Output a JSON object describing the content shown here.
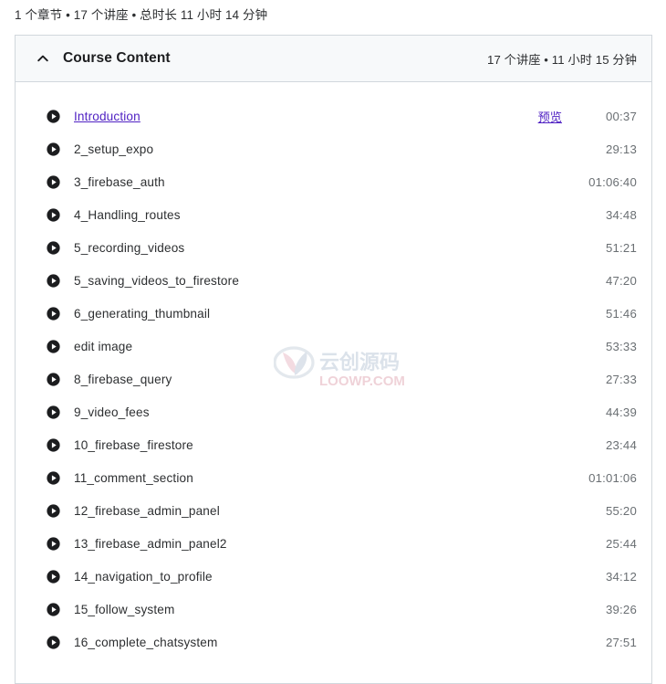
{
  "summary": {
    "text": "1 个章节 • 17 个讲座 • 总时长 11 小时 14 分钟"
  },
  "section": {
    "title": "Course Content",
    "meta": "17 个讲座 • 11 小时 15 分钟",
    "collapse_icon": "chevron-up-icon"
  },
  "colors": {
    "link": "#5022c3",
    "header_bg": "#f7f9fa",
    "border": "#d1d7dc",
    "text": "#2d2f31",
    "muted": "#6a6f73"
  },
  "lectures": [
    {
      "title": "Introduction",
      "duration": "00:37",
      "is_link": true,
      "preview_label": "预览"
    },
    {
      "title": "2_setup_expo",
      "duration": "29:13",
      "is_link": false,
      "preview_label": ""
    },
    {
      "title": "3_firebase_auth",
      "duration": "01:06:40",
      "is_link": false,
      "preview_label": ""
    },
    {
      "title": "4_Handling_routes",
      "duration": "34:48",
      "is_link": false,
      "preview_label": ""
    },
    {
      "title": "5_recording_videos",
      "duration": "51:21",
      "is_link": false,
      "preview_label": ""
    },
    {
      "title": "5_saving_videos_to_firestore",
      "duration": "47:20",
      "is_link": false,
      "preview_label": ""
    },
    {
      "title": "6_generating_thumbnail",
      "duration": "51:46",
      "is_link": false,
      "preview_label": ""
    },
    {
      "title": "edit image",
      "duration": "53:33",
      "is_link": false,
      "preview_label": ""
    },
    {
      "title": "8_firebase_query",
      "duration": "27:33",
      "is_link": false,
      "preview_label": ""
    },
    {
      "title": "9_video_fees",
      "duration": "44:39",
      "is_link": false,
      "preview_label": ""
    },
    {
      "title": "10_firebase_firestore",
      "duration": "23:44",
      "is_link": false,
      "preview_label": ""
    },
    {
      "title": "11_comment_section",
      "duration": "01:01:06",
      "is_link": false,
      "preview_label": ""
    },
    {
      "title": "12_firebase_admin_panel",
      "duration": "55:20",
      "is_link": false,
      "preview_label": ""
    },
    {
      "title": "13_firebase_admin_panel2",
      "duration": "25:44",
      "is_link": false,
      "preview_label": ""
    },
    {
      "title": "14_navigation_to_profile",
      "duration": "34:12",
      "is_link": false,
      "preview_label": ""
    },
    {
      "title": "15_follow_system",
      "duration": "39:26",
      "is_link": false,
      "preview_label": ""
    },
    {
      "title": "16_complete_chatsystem",
      "duration": "27:51",
      "is_link": false,
      "preview_label": ""
    }
  ],
  "watermark": {
    "text_cn": "云创源码",
    "text_en": "LOOWP.COM"
  }
}
